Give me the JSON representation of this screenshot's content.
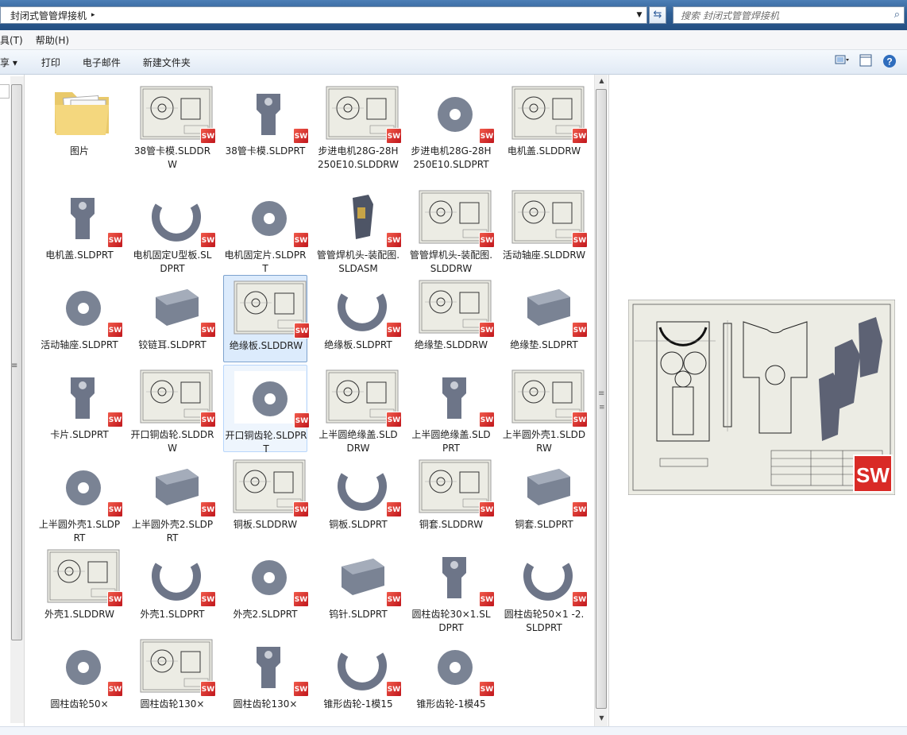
{
  "address": {
    "breadcrumb": "封闭式管管焊接机",
    "separator": "▸",
    "search_placeholder": "搜索 封闭式管管焊接机"
  },
  "menu": {
    "items": [
      "具(T)",
      "帮助(H)"
    ]
  },
  "toolbar": {
    "share": "享 ▾",
    "print": "打印",
    "email": "电子邮件",
    "new_folder": "新建文件夹"
  },
  "icons": {
    "view": "view-options-icon",
    "pane": "preview-pane-icon",
    "help": "help-icon",
    "solidworks": "solidworks-icon"
  },
  "colors": {
    "selection": "#dcebfc",
    "selection_border": "#7da2ce",
    "sw_red": "#d7272b",
    "part_gray": "#7a8394"
  },
  "files": [
    {
      "name": "图片",
      "kind": "folder"
    },
    {
      "name": "38管卡模.SLDDRW",
      "kind": "drw"
    },
    {
      "name": "38管卡模.SLDPRT",
      "kind": "prt"
    },
    {
      "name": "步进电机28G-28H250E10.SLDDRW",
      "kind": "drw"
    },
    {
      "name": "步进电机28G-28H250E10.SLDPRT",
      "kind": "prt"
    },
    {
      "name": "电机盖.SLDDRW",
      "kind": "drw"
    },
    {
      "name": "电机盖.SLDPRT",
      "kind": "prt"
    },
    {
      "name": "电机固定U型板.SLDPRT",
      "kind": "prt"
    },
    {
      "name": "电机固定片.SLDPRT",
      "kind": "prt"
    },
    {
      "name": "管管焊机头-装配图.SLDASM",
      "kind": "asm"
    },
    {
      "name": "管管焊机头-装配图.SLDDRW",
      "kind": "drw"
    },
    {
      "name": "活动轴座.SLDDRW",
      "kind": "drw"
    },
    {
      "name": "活动轴座.SLDPRT",
      "kind": "prt"
    },
    {
      "name": "铰链耳.SLDPRT",
      "kind": "prt"
    },
    {
      "name": "绝缘板.SLDDRW",
      "kind": "drw",
      "state": "selected"
    },
    {
      "name": "绝缘板.SLDPRT",
      "kind": "prt"
    },
    {
      "name": "绝缘垫.SLDDRW",
      "kind": "drw"
    },
    {
      "name": "绝缘垫.SLDPRT",
      "kind": "prt"
    },
    {
      "name": "卡片.SLDPRT",
      "kind": "prt"
    },
    {
      "name": "开口铜齿轮.SLDDRW",
      "kind": "drw"
    },
    {
      "name": "开口铜齿轮.SLDPRT",
      "kind": "prt",
      "state": "hover"
    },
    {
      "name": "上半圆绝缘盖.SLDDRW",
      "kind": "drw"
    },
    {
      "name": "上半圆绝缘盖.SLDPRT",
      "kind": "prt"
    },
    {
      "name": "上半圆外壳1.SLDDRW",
      "kind": "drw"
    },
    {
      "name": "上半圆外壳1.SLDPRT",
      "kind": "prt"
    },
    {
      "name": "上半圆外壳2.SLDPRT",
      "kind": "prt"
    },
    {
      "name": "铜板.SLDDRW",
      "kind": "drw"
    },
    {
      "name": "铜板.SLDPRT",
      "kind": "prt"
    },
    {
      "name": "铜套.SLDDRW",
      "kind": "drw"
    },
    {
      "name": "铜套.SLDPRT",
      "kind": "prt"
    },
    {
      "name": "外壳1.SLDDRW",
      "kind": "drw"
    },
    {
      "name": "外壳1.SLDPRT",
      "kind": "prt"
    },
    {
      "name": "外壳2.SLDPRT",
      "kind": "prt"
    },
    {
      "name": "钨针.SLDPRT",
      "kind": "prt"
    },
    {
      "name": "圆柱齿轮30×1.SLDPRT",
      "kind": "prt"
    },
    {
      "name": "圆柱齿轮50×1 -2.SLDPRT",
      "kind": "prt"
    },
    {
      "name": "圆柱齿轮50×",
      "kind": "prt"
    },
    {
      "name": "圆柱齿轮130×",
      "kind": "drw"
    },
    {
      "name": "圆柱齿轮130×",
      "kind": "prt"
    },
    {
      "name": "锥形齿轮-1模15",
      "kind": "prt"
    },
    {
      "name": "锥形齿轮-1模45",
      "kind": "prt"
    }
  ]
}
